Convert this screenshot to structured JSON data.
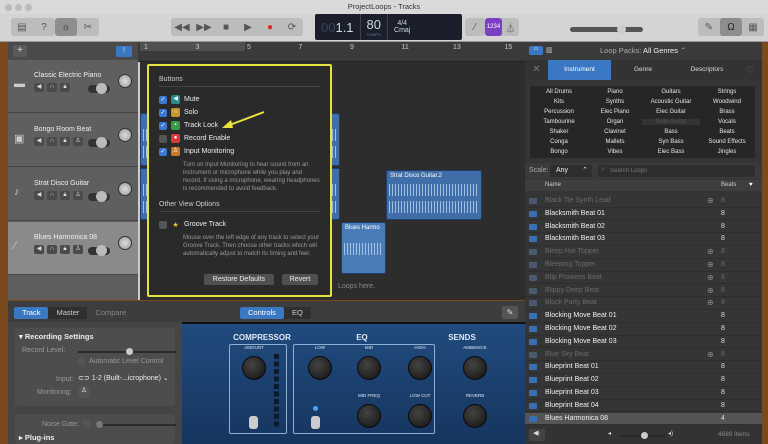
{
  "window": {
    "title": "ProjectLoops - Tracks"
  },
  "toolbar": {
    "icons": [
      "library-icon",
      "help-icon",
      "smart-controls-icon",
      "scissors-icon"
    ],
    "transport": [
      "rewind-icon",
      "fast-forward-icon",
      "stop-icon",
      "play-icon",
      "record-icon",
      "cycle-icon"
    ],
    "lcd": {
      "bar_prefix": "00",
      "position": "1.1",
      "bar_label": "BAR",
      "beat_label": "BEAT",
      "tempo": "80",
      "tempo_label": "TEMPO",
      "time_sig": "4/4",
      "key": "Cmaj"
    },
    "count_in": "1234",
    "master_volume": 0.55
  },
  "colors": {
    "accent": "#3b78c4",
    "popup_border": "#e8e23c",
    "count_in": "#7b3fc4",
    "region": "#3f6ea8"
  },
  "tracks": [
    {
      "name": "Classic Electric Piano",
      "icon": "piano-icon",
      "buttons": [
        "mute",
        "solo",
        "lock"
      ]
    },
    {
      "name": "Bongo Room Beat",
      "icon": "drum-machine-icon",
      "buttons": [
        "mute",
        "solo",
        "lock",
        "input-monitor"
      ]
    },
    {
      "name": "Strat Disco Guitar",
      "icon": "guitar-icon",
      "buttons": [
        "mute",
        "solo",
        "lock",
        "input-monitor"
      ]
    },
    {
      "name": "Blues Harmonica 08",
      "icon": "harmonica-icon",
      "buttons": [
        "mute",
        "solo",
        "lock",
        "input-monitor"
      ],
      "selected": true
    }
  ],
  "ruler": [
    "1",
    "3",
    "5",
    "7",
    "9",
    "11",
    "13",
    "15"
  ],
  "regions": [
    {
      "name": "Strat Disco Guitar.2"
    },
    {
      "name": "Blues Harmo"
    }
  ],
  "arrange_hint": "Loops here.",
  "popup": {
    "buttons_header": "Buttons",
    "items": [
      {
        "label": "Mute",
        "checked": true,
        "icon": "mute-icon",
        "color": "#2a8c8c"
      },
      {
        "label": "Solo",
        "checked": true,
        "icon": "headphones-icon",
        "color": "#c8962a"
      },
      {
        "label": "Track Lock",
        "checked": true,
        "icon": "lock-icon",
        "color": "#3a9a4a"
      },
      {
        "label": "Record Enable",
        "checked": false,
        "icon": "record-icon",
        "color": "#d83a3a"
      },
      {
        "label": "Input Monitoring",
        "checked": true,
        "icon": "input-monitor-icon",
        "color": "#c87a2a"
      }
    ],
    "input_desc": "Turn on Input Monitoring to hear sound from an instrument or microphone while you play and record. If using a microphone, wearing headphones is recommended to avoid feedback.",
    "other_header": "Other View Options",
    "groove_label": "Groove Track",
    "groove_checked": false,
    "groove_desc": "Mouse over the left edge of any track to select your Groove Track. Then choose other tracks which will automatically adjust to match its timing and feel.",
    "restore": "Restore Defaults",
    "revert": "Revert"
  },
  "bottom": {
    "tabs": [
      "Track",
      "Master",
      "Compare"
    ],
    "plugin_tabs": [
      "Controls",
      "EQ"
    ],
    "recording_settings": "Recording Settings",
    "record_level": "Record Level:",
    "record_level_value": 0.5,
    "auto_level": "Automatic Level Control",
    "input_label": "Input:",
    "input_value": "1-2  (Built-...icrophone)",
    "monitoring_label": "Monitoring:",
    "noise_gate": "Noise Gate:",
    "plugins": "Plug-ins"
  },
  "plugin": {
    "compressor": "COMPRESSOR",
    "eq": "EQ",
    "sends": "SENDS",
    "amount": "AMOUNT",
    "low": "LOW",
    "mid": "MID",
    "high": "HIGH",
    "mid_freq": "MID FREQ",
    "low_cut": "LOW CUT",
    "ambience": "AMBIENCE",
    "reverb": "REVERB"
  },
  "browser": {
    "loop_packs_label": "Loop Packs:",
    "loop_packs_value": "All Genres",
    "filter_tabs": [
      "Instrument",
      "Genre",
      "Descriptors"
    ],
    "grid": [
      [
        "All Drums",
        "Piano",
        "Guitars",
        "Strings"
      ],
      [
        "Kits",
        "Synths",
        "Acoustic Guitar",
        "Woodwind"
      ],
      [
        "Percussion",
        "Elec Piano",
        "Elec Guitar",
        "Brass"
      ],
      [
        "Tambourine",
        "Organ",
        "Slide Guitar",
        "Vocals"
      ],
      [
        "Shaker",
        "Clavinet",
        "Bass",
        "Beats"
      ],
      [
        "Conga",
        "Mallets",
        "Syn Bass",
        "Sound Effects"
      ],
      [
        "Bongo",
        "Vibes",
        "Elec Bass",
        "Jingles"
      ]
    ],
    "scale_label": "Scale:",
    "scale_value": "Any",
    "search_placeholder": "Search Loops",
    "col_name": "Name",
    "col_beats": "Beats",
    "loops": [
      {
        "name": "Black Tie Synth Lead",
        "beats": "8",
        "downloaded": false
      },
      {
        "name": "Blacksmith Beat 01",
        "beats": "8",
        "downloaded": true
      },
      {
        "name": "Blacksmith Beat 02",
        "beats": "8",
        "downloaded": true
      },
      {
        "name": "Blacksmith Beat 03",
        "beats": "8",
        "downloaded": true
      },
      {
        "name": "Bleep Hat Topper",
        "beats": "8",
        "downloaded": false
      },
      {
        "name": "Bleeping Topper",
        "beats": "8",
        "downloaded": false
      },
      {
        "name": "Blip Prowess Beat",
        "beats": "8",
        "downloaded": false
      },
      {
        "name": "Blippy Deep Beat",
        "beats": "8",
        "downloaded": false
      },
      {
        "name": "Block Party Beat",
        "beats": "8",
        "downloaded": false
      },
      {
        "name": "Blocking Move Beat 01",
        "beats": "8",
        "downloaded": true
      },
      {
        "name": "Blocking Move Beat 02",
        "beats": "8",
        "downloaded": true
      },
      {
        "name": "Blocking Move Beat 03",
        "beats": "8",
        "downloaded": true
      },
      {
        "name": "Blue Sky Beat",
        "beats": "8",
        "downloaded": false
      },
      {
        "name": "Blueprint Beat 01",
        "beats": "8",
        "downloaded": true
      },
      {
        "name": "Blueprint Beat 02",
        "beats": "8",
        "downloaded": true
      },
      {
        "name": "Blueprint Beat 03",
        "beats": "8",
        "downloaded": true
      },
      {
        "name": "Blueprint Beat 04",
        "beats": "8",
        "downloaded": true
      },
      {
        "name": "Blues Harmonica 08",
        "beats": "4",
        "downloaded": true,
        "selected": true
      }
    ],
    "preview_volume": 0.55,
    "item_count": "4689 items"
  }
}
